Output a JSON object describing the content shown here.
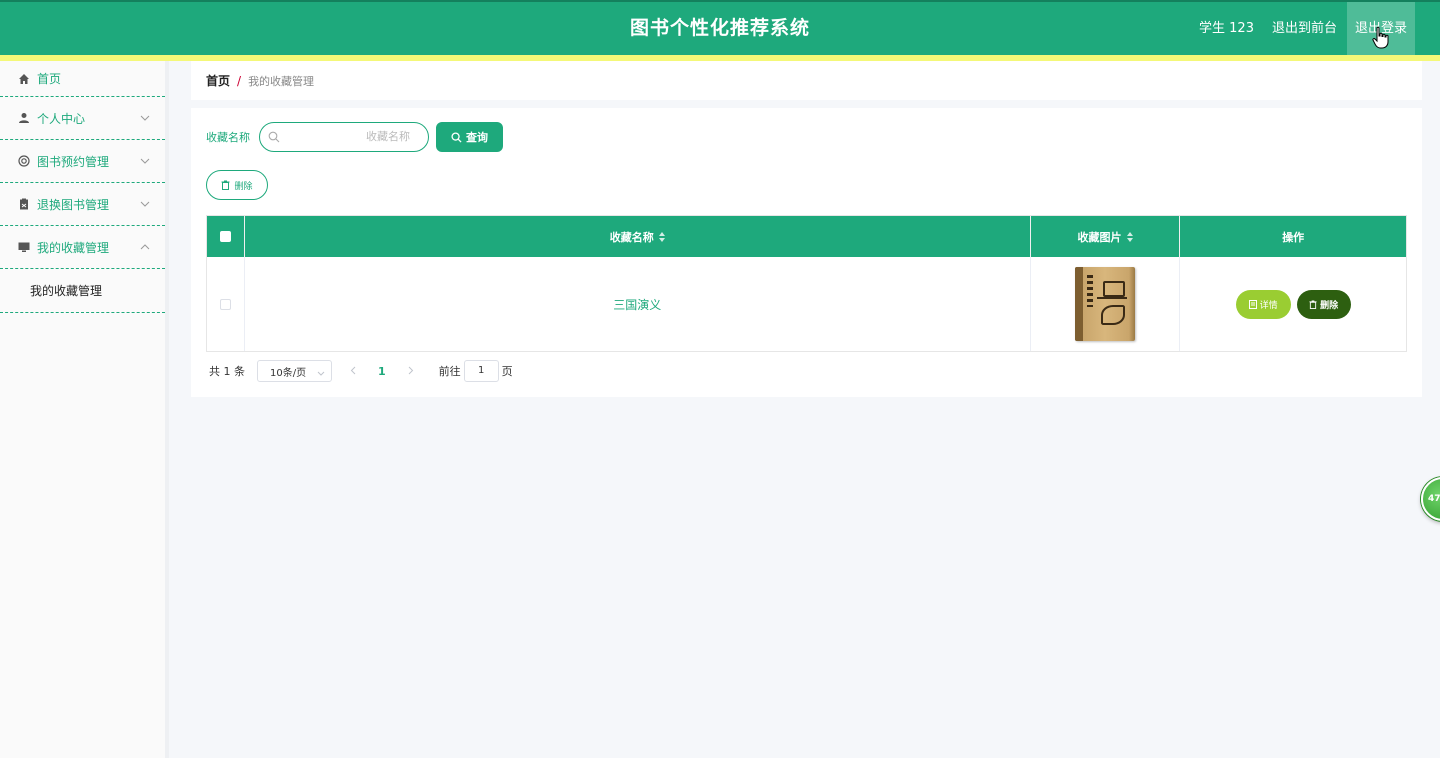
{
  "header": {
    "title": "图书个性化推荐系统",
    "user": "学生 123",
    "back_to_front": "退出到前台",
    "logout": "退出登录"
  },
  "sidebar": {
    "items": [
      {
        "label": "首页",
        "icon": "home-icon"
      },
      {
        "label": "个人中心",
        "icon": "user-icon"
      },
      {
        "label": "图书预约管理",
        "icon": "lifebuoy-icon"
      },
      {
        "label": "退换图书管理",
        "icon": "clipboard-icon"
      },
      {
        "label": "我的收藏管理",
        "icon": "monitor-icon",
        "expanded": true
      }
    ],
    "sub_items": [
      {
        "label": "我的收藏管理"
      }
    ]
  },
  "breadcrumb": {
    "home": "首页",
    "separator": "/",
    "current": "我的收藏管理"
  },
  "search": {
    "label": "收藏名称",
    "placeholder": "收藏名称",
    "value": "",
    "query_button": "查询"
  },
  "toolbar": {
    "delete_button": "删除"
  },
  "table": {
    "columns": [
      "收藏名称",
      "收藏图片",
      "操作"
    ],
    "rows": [
      {
        "name": "三国演义",
        "detail_button": "详情",
        "delete_button": "删除"
      }
    ]
  },
  "pagination": {
    "total_text": "共 1 条",
    "page_size": "10条/页",
    "current_page": "1",
    "goto_label": "前往",
    "goto_value": "1",
    "page_unit": "页"
  },
  "float_widget": {
    "text": "47"
  },
  "colors": {
    "primary": "#1ea97c",
    "yellow_strip": "#f4f878",
    "detail_button": "#9acd32",
    "delete_button": "#2d5f10"
  }
}
